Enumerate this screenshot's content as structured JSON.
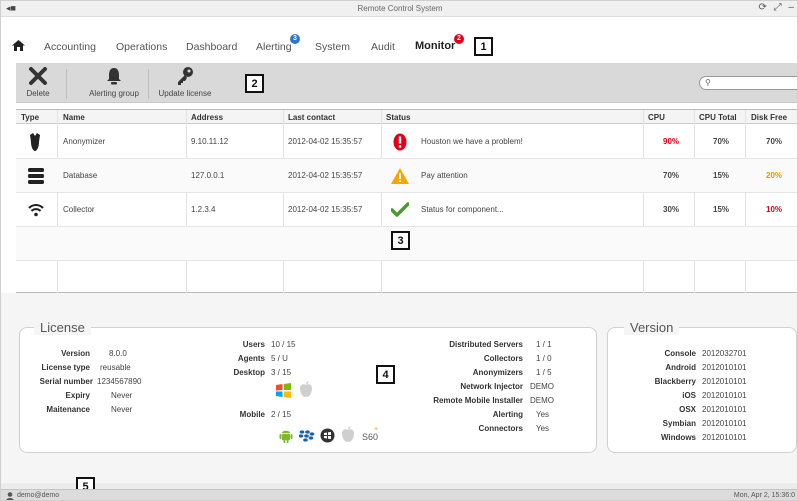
{
  "window": {
    "title": "Remote Control System",
    "controls": "⟳ ⤢ –"
  },
  "menu": {
    "items": [
      {
        "label": "Accounting"
      },
      {
        "label": "Operations"
      },
      {
        "label": "Dashboard"
      },
      {
        "label": "Alerting",
        "badge": "3"
      },
      {
        "label": "System"
      },
      {
        "label": "Audit"
      },
      {
        "label": "Monitor",
        "badge": "2",
        "active": true
      }
    ]
  },
  "callouts": [
    "1",
    "2",
    "3",
    "4",
    "5"
  ],
  "toolbar": {
    "delete_label": "Delete",
    "alerting_group_label": "Alerting group",
    "update_license_label": "Update license",
    "search_placeholder": ""
  },
  "table": {
    "headers": [
      "Type",
      "Name",
      "Address",
      "Last contact",
      "Status",
      "CPU",
      "CPU Total",
      "Disk Free"
    ],
    "rows": [
      {
        "icon": "anonymizer-icon",
        "name": "Anonymizer",
        "address": "9.10.11.12",
        "last_contact": "2012-04-02 15:35:57",
        "status_icon": "error-icon",
        "status": "Houston we have a problem!",
        "cpu": "90%",
        "cpu_total": "70%",
        "disk_free": "70%"
      },
      {
        "icon": "database-icon",
        "name": "Database",
        "address": "127.0.0.1",
        "last_contact": "2012-04-02 15:35:57",
        "status_icon": "warning-icon",
        "status": "Pay attention",
        "cpu": "70%",
        "cpu_total": "15%",
        "disk_free": "20%"
      },
      {
        "icon": "wifi-icon",
        "name": "Collector",
        "address": "1.2.3.4",
        "last_contact": "2012-04-02 15:35:57",
        "status_icon": "check-icon",
        "status": "Status for component...",
        "cpu": "30%",
        "cpu_total": "15%",
        "disk_free": "10%"
      }
    ]
  },
  "license": {
    "title": "License",
    "version_k": "Version",
    "version_v": "8.0.0",
    "type_k": "License type",
    "type_v": "reusable",
    "serial_k": "Serial number",
    "serial_v": "1234567890",
    "expiry_k": "Expiry",
    "expiry_v": "Never",
    "maint_k": "Maitenance",
    "maint_v": "Never",
    "users_k": "Users",
    "users_v": "10 / 15",
    "agents_k": "Agents",
    "agents_v": "5 / U",
    "desktop_k": "Desktop",
    "desktop_v": "3 / 15",
    "mobile_k": "Mobile",
    "mobile_v": "2 / 15",
    "dist_k": "Distributed Servers",
    "dist_v": "1 / 1",
    "coll_k": "Collectors",
    "coll_v": "1 / 0",
    "anon_k": "Anonymizers",
    "anon_v": "1 / 5",
    "ni_k": "Network Injector",
    "ni_v": "DEMO",
    "rmi_k": "Remote Mobile Installer",
    "rmi_v": "DEMO",
    "alert_k": "Alerting",
    "alert_v": "Yes",
    "conn_k": "Connectors",
    "conn_v": "Yes",
    "s60_label": "S60"
  },
  "version": {
    "title": "Version",
    "console_k": "Console",
    "console_v": "2012032701",
    "android_k": "Android",
    "android_v": "2012010101",
    "bb_k": "Blackberry",
    "bb_v": "2012010101",
    "ios_k": "iOS",
    "ios_v": "2012010101",
    "osx_k": "OSX",
    "osx_v": "2012010101",
    "symbian_k": "Symbian",
    "symbian_v": "2012010101",
    "windows_k": "Windows",
    "windows_v": "2012010101"
  },
  "status": {
    "user": "demo@demo",
    "datetime": "Mon, Apr 2, 15:36:0"
  },
  "colors": {
    "alert_red": "#e0001a",
    "warn_orange": "#f29000",
    "ok_green": "#4a9b2f",
    "badge_blue": "#2a78c8"
  }
}
